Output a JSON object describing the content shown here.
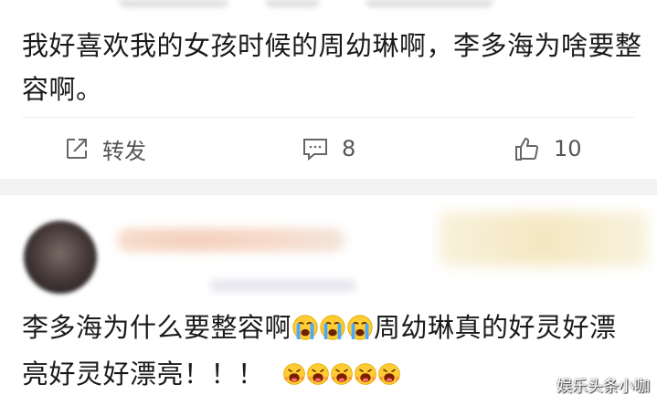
{
  "post": {
    "text": "我好喜欢我的女孩时候的周幼琳啊，李多海为啥要整容啊。"
  },
  "actions": {
    "repost": {
      "icon": "share-icon",
      "label": "转发"
    },
    "comment": {
      "icon": "comment-icon",
      "count": "8"
    },
    "like": {
      "icon": "thumbs-up-icon",
      "count": "10"
    }
  },
  "comment": {
    "text_part1": "李多海为什么要整容啊",
    "crying_emoji_count": 3,
    "text_part2": "周幼琳真的好灵好漂亮好灵好漂亮！！！",
    "screaming_emoji_count": 5
  },
  "watermark": "娱乐头条小咖"
}
